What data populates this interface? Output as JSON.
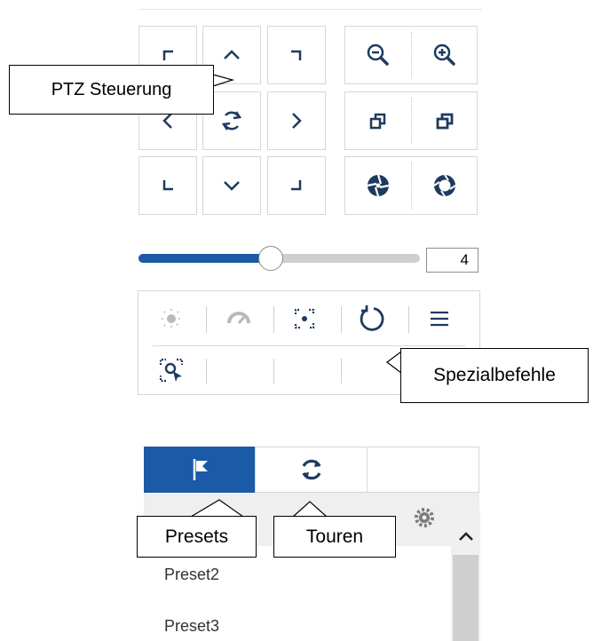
{
  "ptz": {
    "directions": [
      "up-left",
      "up",
      "up-right",
      "left",
      "auto-pan",
      "right",
      "down-left",
      "down",
      "down-right"
    ],
    "zoom": [
      "zoom-out",
      "zoom-in"
    ],
    "focus": [
      "focus-near",
      "focus-far"
    ],
    "iris": [
      "iris-close",
      "iris-open"
    ]
  },
  "speed": {
    "value": "4",
    "level_fraction": 0.47
  },
  "special": {
    "row1": [
      "light-icon",
      "wiper-icon",
      "one-touch-focus-icon",
      "lens-init-icon",
      "menu-icon"
    ],
    "row2": [
      "manual-track-icon",
      "",
      "",
      "",
      ""
    ]
  },
  "tabs": [
    {
      "name": "presets",
      "icon": "flag-icon",
      "active": true
    },
    {
      "name": "tours",
      "icon": "refresh-icon",
      "active": false
    },
    {
      "name": "empty",
      "icon": "",
      "active": false
    }
  ],
  "list": {
    "items": [
      "Preset2",
      "Preset3"
    ]
  },
  "callouts": {
    "ptz": "PTZ Steuerung",
    "special": "Spezialbefehle",
    "presets": "Presets",
    "tours": "Touren"
  },
  "colors": {
    "accent": "#1a5aa6",
    "icon": "#1e3a5f",
    "disabled": "#b9b9b9"
  }
}
